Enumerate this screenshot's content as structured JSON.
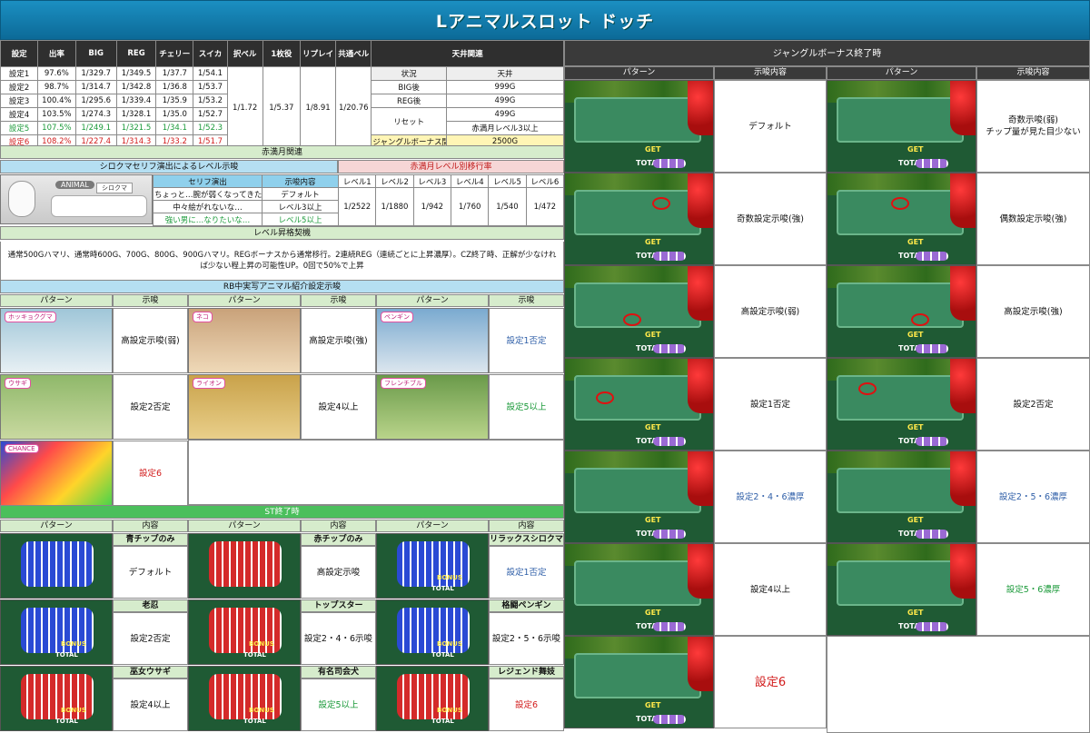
{
  "title": "Lアニマルスロット ドッチ",
  "colors": {
    "header": "#1b8fc2",
    "green_text": "#1b9a3a",
    "red_text": "#d21c1c",
    "blue_text": "#2f5fa8"
  },
  "settings_table": {
    "headers": [
      "設定",
      "出率",
      "BIG",
      "REG",
      "チェリー",
      "スイカ",
      "択ベル",
      "1枚役",
      "リプレイ",
      "共通ベル"
    ],
    "rows": [
      [
        "設定1",
        "97.6%",
        "1/329.7",
        "1/349.5",
        "1/37.7",
        "1/54.1"
      ],
      [
        "設定2",
        "98.7%",
        "1/314.7",
        "1/342.8",
        "1/36.8",
        "1/53.7"
      ],
      [
        "設定3",
        "100.4%",
        "1/295.6",
        "1/339.4",
        "1/35.9",
        "1/53.2"
      ],
      [
        "設定4",
        "103.5%",
        "1/274.3",
        "1/328.1",
        "1/35.0",
        "1/52.7"
      ],
      [
        "設定5",
        "107.5%",
        "1/249.1",
        "1/321.5",
        "1/34.1",
        "1/52.3"
      ],
      [
        "設定6",
        "108.2%",
        "1/227.4",
        "1/314.3",
        "1/33.2",
        "1/51.7"
      ]
    ],
    "common": [
      "1/1.72",
      "1/5.37",
      "1/8.91",
      "1/20.76"
    ]
  },
  "tenjou": {
    "title": "天井関連",
    "headers": [
      "状況",
      "天井"
    ],
    "rows": [
      [
        "BIG後",
        "999G"
      ],
      [
        "REG後",
        "499G"
      ]
    ],
    "reset_label": "リセット",
    "reset_values": [
      "499G",
      "赤満月レベル3以上"
    ],
    "jungle_label": "ジャングルボーナス間",
    "jungle_value": "2500G"
  },
  "akamangetsu": {
    "title": "赤満月関連",
    "shirokuma_title": "シロクマセリフ演出によるレベル示唆",
    "shirokuma_headers": [
      "セリフ演出",
      "示唆内容"
    ],
    "shirokuma_rows": [
      [
        "ちょっと…腕が弱くなってきた…",
        "デフォルト"
      ],
      [
        "中々絵がれないな…",
        "レベル3以上"
      ],
      [
        "強い男に…なりたいな…",
        "レベル5以上"
      ]
    ],
    "image_label": "ANIMAL",
    "image_name": "シロクマ",
    "level_title": "赤満月レベル別移行率",
    "level_headers": [
      "レベル1",
      "レベル2",
      "レベル3",
      "レベル4",
      "レベル5",
      "レベル6"
    ],
    "level_values": [
      "1/2522",
      "1/1880",
      "1/942",
      "1/760",
      "1/540",
      "1/472"
    ]
  },
  "level_up": {
    "title": "レベル昇格契機",
    "text": "通常500Gハマリ、通常時600G、700G、800G、900Gハマリ。REGボーナスから通常移行。2連続REG（連続ごとに上昇濃厚）。CZ終了時、正解が少なければ少ない程上昇の可能性UP。0回で50%で上昇"
  },
  "rb": {
    "title": "RB中実写アニマル紹介設定示唆",
    "headers": [
      "パターン",
      "示唆",
      "パターン",
      "示唆",
      "パターン",
      "示唆"
    ],
    "cells": [
      {
        "caption": "ホッキョクグマ",
        "text": "高設定示唆(弱)",
        "color": ""
      },
      {
        "caption": "ネコ",
        "text": "高設定示唆(強)",
        "color": ""
      },
      {
        "caption": "ペンギン",
        "text": "設定1否定",
        "color": "blue"
      },
      {
        "caption": "ウサギ",
        "text": "設定2否定",
        "color": ""
      },
      {
        "caption": "ライオン",
        "text": "設定4以上",
        "color": ""
      },
      {
        "caption": "フレンチブル",
        "text": "設定5以上",
        "color": "green"
      },
      {
        "caption": "CHANCE",
        "text": "設定6",
        "color": "red"
      }
    ]
  },
  "st": {
    "title": "ST終了時",
    "headers": [
      "パターン",
      "内容",
      "パターン",
      "内容",
      "パターン",
      "内容"
    ],
    "cells": [
      {
        "label": "青チップのみ",
        "text": "デフォルト",
        "color": ""
      },
      {
        "label": "赤チップのみ",
        "text": "高設定示唆",
        "color": ""
      },
      {
        "label": "リラックスシロクマ",
        "text": "設定1否定",
        "color": "blue"
      },
      {
        "label": "老忍",
        "text": "設定2否定",
        "color": ""
      },
      {
        "label": "トップスター",
        "text": "設定2・4・6示唆",
        "color": ""
      },
      {
        "label": "格闘ペンギン",
        "text": "設定2・5・6示唆",
        "color": ""
      },
      {
        "label": "巫女ウサギ",
        "text": "設定4以上",
        "color": ""
      },
      {
        "label": "有名司会犬",
        "text": "設定5以上",
        "color": "green"
      },
      {
        "label": "レジェンド舞妓",
        "text": "設定6",
        "color": "red"
      }
    ],
    "bonus_text": "BONUS",
    "total_text": "TOTAL"
  },
  "jungle": {
    "title": "ジャングルボーナス終了時",
    "headers": [
      "パターン",
      "示唆内容",
      "パターン",
      "示唆内容"
    ],
    "cells": [
      {
        "text": "デフォルト",
        "color": ""
      },
      {
        "text": "奇数示唆(弱)\nチップ量が見た目少ない",
        "color": ""
      },
      {
        "text": "奇数設定示唆(強)",
        "color": ""
      },
      {
        "text": "偶数設定示唆(強)",
        "color": ""
      },
      {
        "text": "高設定示唆(弱)",
        "color": ""
      },
      {
        "text": "高設定示唆(強)",
        "color": ""
      },
      {
        "text": "設定1否定",
        "color": ""
      },
      {
        "text": "設定2否定",
        "color": ""
      },
      {
        "text": "設定2・4・6濃厚",
        "color": "blue"
      },
      {
        "text": "設定2・5・6濃厚",
        "color": "blue"
      },
      {
        "text": "設定4以上",
        "color": ""
      },
      {
        "text": "設定5・6濃厚",
        "color": "green"
      },
      {
        "text": "設定6",
        "color": "red"
      }
    ],
    "get_text": "GET",
    "total_text": "TOTAL"
  }
}
